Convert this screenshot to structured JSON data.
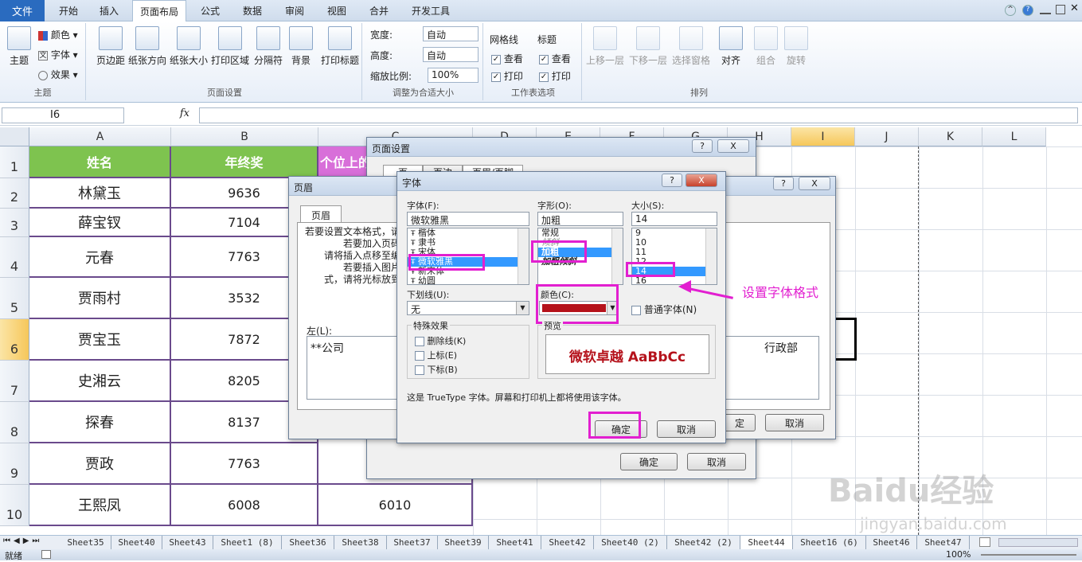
{
  "ribbon_tabs": [
    "文件",
    "开始",
    "插入",
    "页面布局",
    "公式",
    "数据",
    "审阅",
    "视图",
    "合并",
    "开发工具"
  ],
  "ribbon": {
    "theme": {
      "big": "主题",
      "colors": "颜色",
      "fonts": "字体",
      "effects": "效果",
      "group": "主题"
    },
    "page_setup": {
      "buttons": [
        "页边距",
        "纸张方向",
        "纸张大小",
        "打印区域",
        "分隔符",
        "背景",
        "打印标题"
      ],
      "group": "页面设置"
    },
    "scale": {
      "width_label": "宽度:",
      "width_value": "自动",
      "height_label": "高度:",
      "height_value": "自动",
      "scale_label": "缩放比例:",
      "scale_value": "100%",
      "group": "调整为合适大小"
    },
    "sheet_options": {
      "gridlines": "网格线",
      "headings": "标题",
      "view": "查看",
      "print": "打印",
      "group": "工作表选项"
    },
    "arrange": {
      "buttons": [
        "上移一层",
        "下移一层",
        "选择窗格",
        "对齐",
        "组合",
        "旋转"
      ],
      "group": "排列"
    }
  },
  "namebox": "I6",
  "fx": "fx",
  "columns": [
    "A",
    "B",
    "C",
    "D",
    "E",
    "F",
    "G",
    "H",
    "I",
    "J",
    "K",
    "L"
  ],
  "rows": [
    "1",
    "2",
    "3",
    "4",
    "5",
    "6",
    "7",
    "8",
    "9",
    "10"
  ],
  "table": {
    "headers": [
      "姓名",
      "年终奖",
      "个位上的"
    ],
    "rows": [
      [
        "林黛玉",
        "9636"
      ],
      [
        "薛宝钗",
        "7104"
      ],
      [
        "元春",
        "7763"
      ],
      [
        "贾雨村",
        "3532"
      ],
      [
        "贾宝玉",
        "7872"
      ],
      [
        "史湘云",
        "8205"
      ],
      [
        "探春",
        "8137"
      ],
      [
        "贾政",
        "7763"
      ],
      [
        "王熙凤",
        "6008",
        "6010"
      ]
    ]
  },
  "sheets": [
    "Sheet35",
    "Sheet40",
    "Sheet43",
    "Sheet1 (8)",
    "Sheet36",
    "Sheet38",
    "Sheet37",
    "Sheet39",
    "Sheet41",
    "Sheet42",
    "Sheet40 (2)",
    "Sheet42 (2)",
    "Sheet44",
    "Sheet16 (6)",
    "Sheet46",
    "Sheet47"
  ],
  "status": {
    "ready": "就绪",
    "zoom": "100%"
  },
  "page_setup_dialog": {
    "title": "页面设置",
    "help": "?",
    "close": "X",
    "tabs": [
      "页",
      "页边",
      "页眉/页脚"
    ],
    "ok": "确定",
    "cancel": "取消"
  },
  "header_dialog": {
    "title": "页眉",
    "help": "?",
    "close": "X",
    "tab": "页眉",
    "instructions": [
      "若要设置文本格式，请",
      "若要加入页码",
      "请将插入点移至编",
      "若要插入图片",
      "式，请将光标放到"
    ],
    "left_label": "左(L):",
    "left_value": "**公司",
    "right_value": "行政部",
    "ok": "定",
    "cancel": "取消"
  },
  "font_dialog": {
    "title": "字体",
    "help": "?",
    "close": "X",
    "font_label": "字体(F):",
    "font_value": "微软雅黑",
    "fonts": [
      "楷体",
      "隶书",
      "宋体",
      "微软雅黑",
      "新宋体",
      "幼圆"
    ],
    "style_label": "字形(O):",
    "style_value": "加粗",
    "styles": [
      "常规",
      "倾斜",
      "加粗",
      "加粗倾斜"
    ],
    "size_label": "大小(S):",
    "size_value": "14",
    "sizes": [
      "9",
      "10",
      "11",
      "12",
      "14",
      "16"
    ],
    "underline_label": "下划线(U):",
    "underline_value": "无",
    "color_label": "颜色(C):",
    "color_value": "#b5121b",
    "normal_font": "普通字体(N)",
    "effects_label": "特殊效果",
    "effects": [
      "删除线(K)",
      "上标(E)",
      "下标(B)"
    ],
    "preview_label": "预览",
    "preview_text": "微软卓越  AaBbCc",
    "note": "这是 TrueType 字体。屏幕和打印机上都将使用该字体。",
    "ok": "确定",
    "cancel": "取消"
  },
  "annotation": "设置字体格式",
  "watermark": {
    "brand": "Baidu经验",
    "url": "jingyan.baidu.com"
  },
  "colors": {
    "header_green": "#7ec34f",
    "highlight": "#e21fd0",
    "file_tab": "#2a6bbf"
  }
}
